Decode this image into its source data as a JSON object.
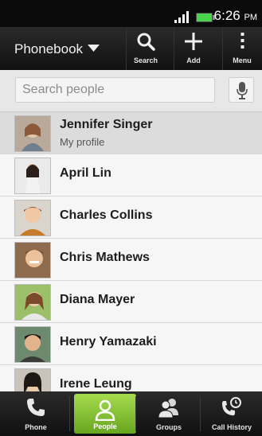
{
  "status_bar": {
    "time": "6:26",
    "ampm": "PM"
  },
  "header": {
    "title": "Phonebook",
    "actions": [
      {
        "label": "Search",
        "icon": "search-icon"
      },
      {
        "label": "Add",
        "icon": "plus-icon"
      },
      {
        "label": "Menu",
        "icon": "more-vertical-icon"
      }
    ]
  },
  "search": {
    "placeholder": "Search people",
    "value": ""
  },
  "contacts": [
    {
      "name": "Jennifer Singer",
      "subtitle": "My profile"
    },
    {
      "name": "April Lin"
    },
    {
      "name": "Charles Collins"
    },
    {
      "name": "Chris Mathews"
    },
    {
      "name": "Diana Mayer"
    },
    {
      "name": "Henry Yamazaki"
    },
    {
      "name": "Irene Leung"
    }
  ],
  "tabs": [
    {
      "label": "Phone",
      "icon": "phone-icon",
      "active": false
    },
    {
      "label": "People",
      "icon": "person-icon",
      "active": true
    },
    {
      "label": "Groups",
      "icon": "groups-icon",
      "active": false
    },
    {
      "label": "Call History",
      "icon": "call-history-icon",
      "active": false
    }
  ],
  "colors": {
    "accent": "#8cc63f",
    "header_bg": "#1a1a1a",
    "list_bg": "#f6f6f6"
  }
}
